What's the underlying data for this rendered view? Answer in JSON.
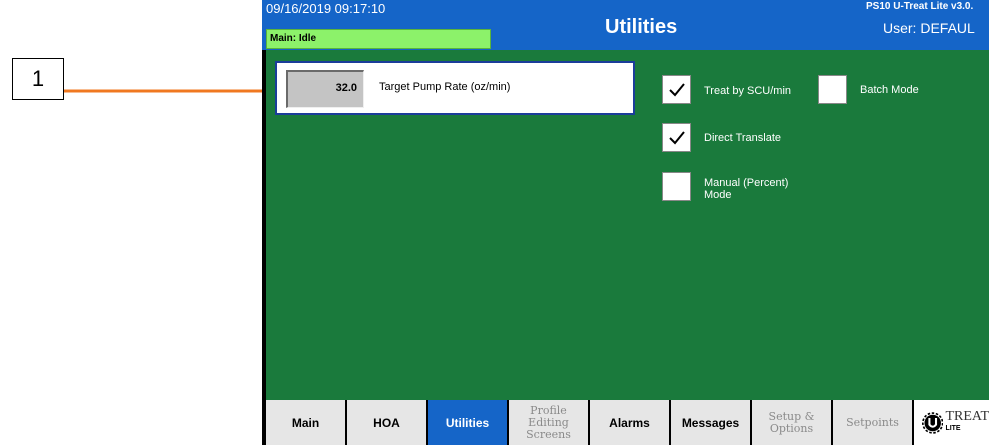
{
  "callout": {
    "number": "1"
  },
  "header": {
    "datetime": "09/16/2019 09:17:10",
    "status": "Main: Idle",
    "title": "Utilities",
    "version": "PS10 U-Treat Lite v3.0.",
    "user": "User: DEFAUL"
  },
  "pump": {
    "value": "32.0",
    "label": "Target Pump Rate (oz/min)"
  },
  "options": {
    "treat_by_scu": {
      "label": "Treat by SCU/min",
      "checked": true
    },
    "batch_mode": {
      "label": "Batch Mode",
      "checked": false
    },
    "direct_translate": {
      "label": "Direct Translate",
      "checked": true
    },
    "manual_percent": {
      "label": "Manual (Percent)\nMode",
      "checked": false
    }
  },
  "tabs": [
    {
      "label": "Main",
      "state": "normal"
    },
    {
      "label": "HOA",
      "state": "normal"
    },
    {
      "label": "Utilities",
      "state": "active"
    },
    {
      "label": "Profile\nEditing\nScreens",
      "state": "disabled"
    },
    {
      "label": "Alarms",
      "state": "normal"
    },
    {
      "label": "Messages",
      "state": "normal"
    },
    {
      "label": "Setup &\nOptions",
      "state": "disabled"
    },
    {
      "label": "Setpoints",
      "state": "disabled"
    }
  ],
  "logo": {
    "text": "TREAT",
    "sub": "LITE"
  },
  "colors": {
    "header": "#1565c8",
    "main_bg": "#1a7a3c",
    "status_bar": "#8cf26a",
    "callout_arrow": "#f07820",
    "active_tab": "#1565c8"
  }
}
